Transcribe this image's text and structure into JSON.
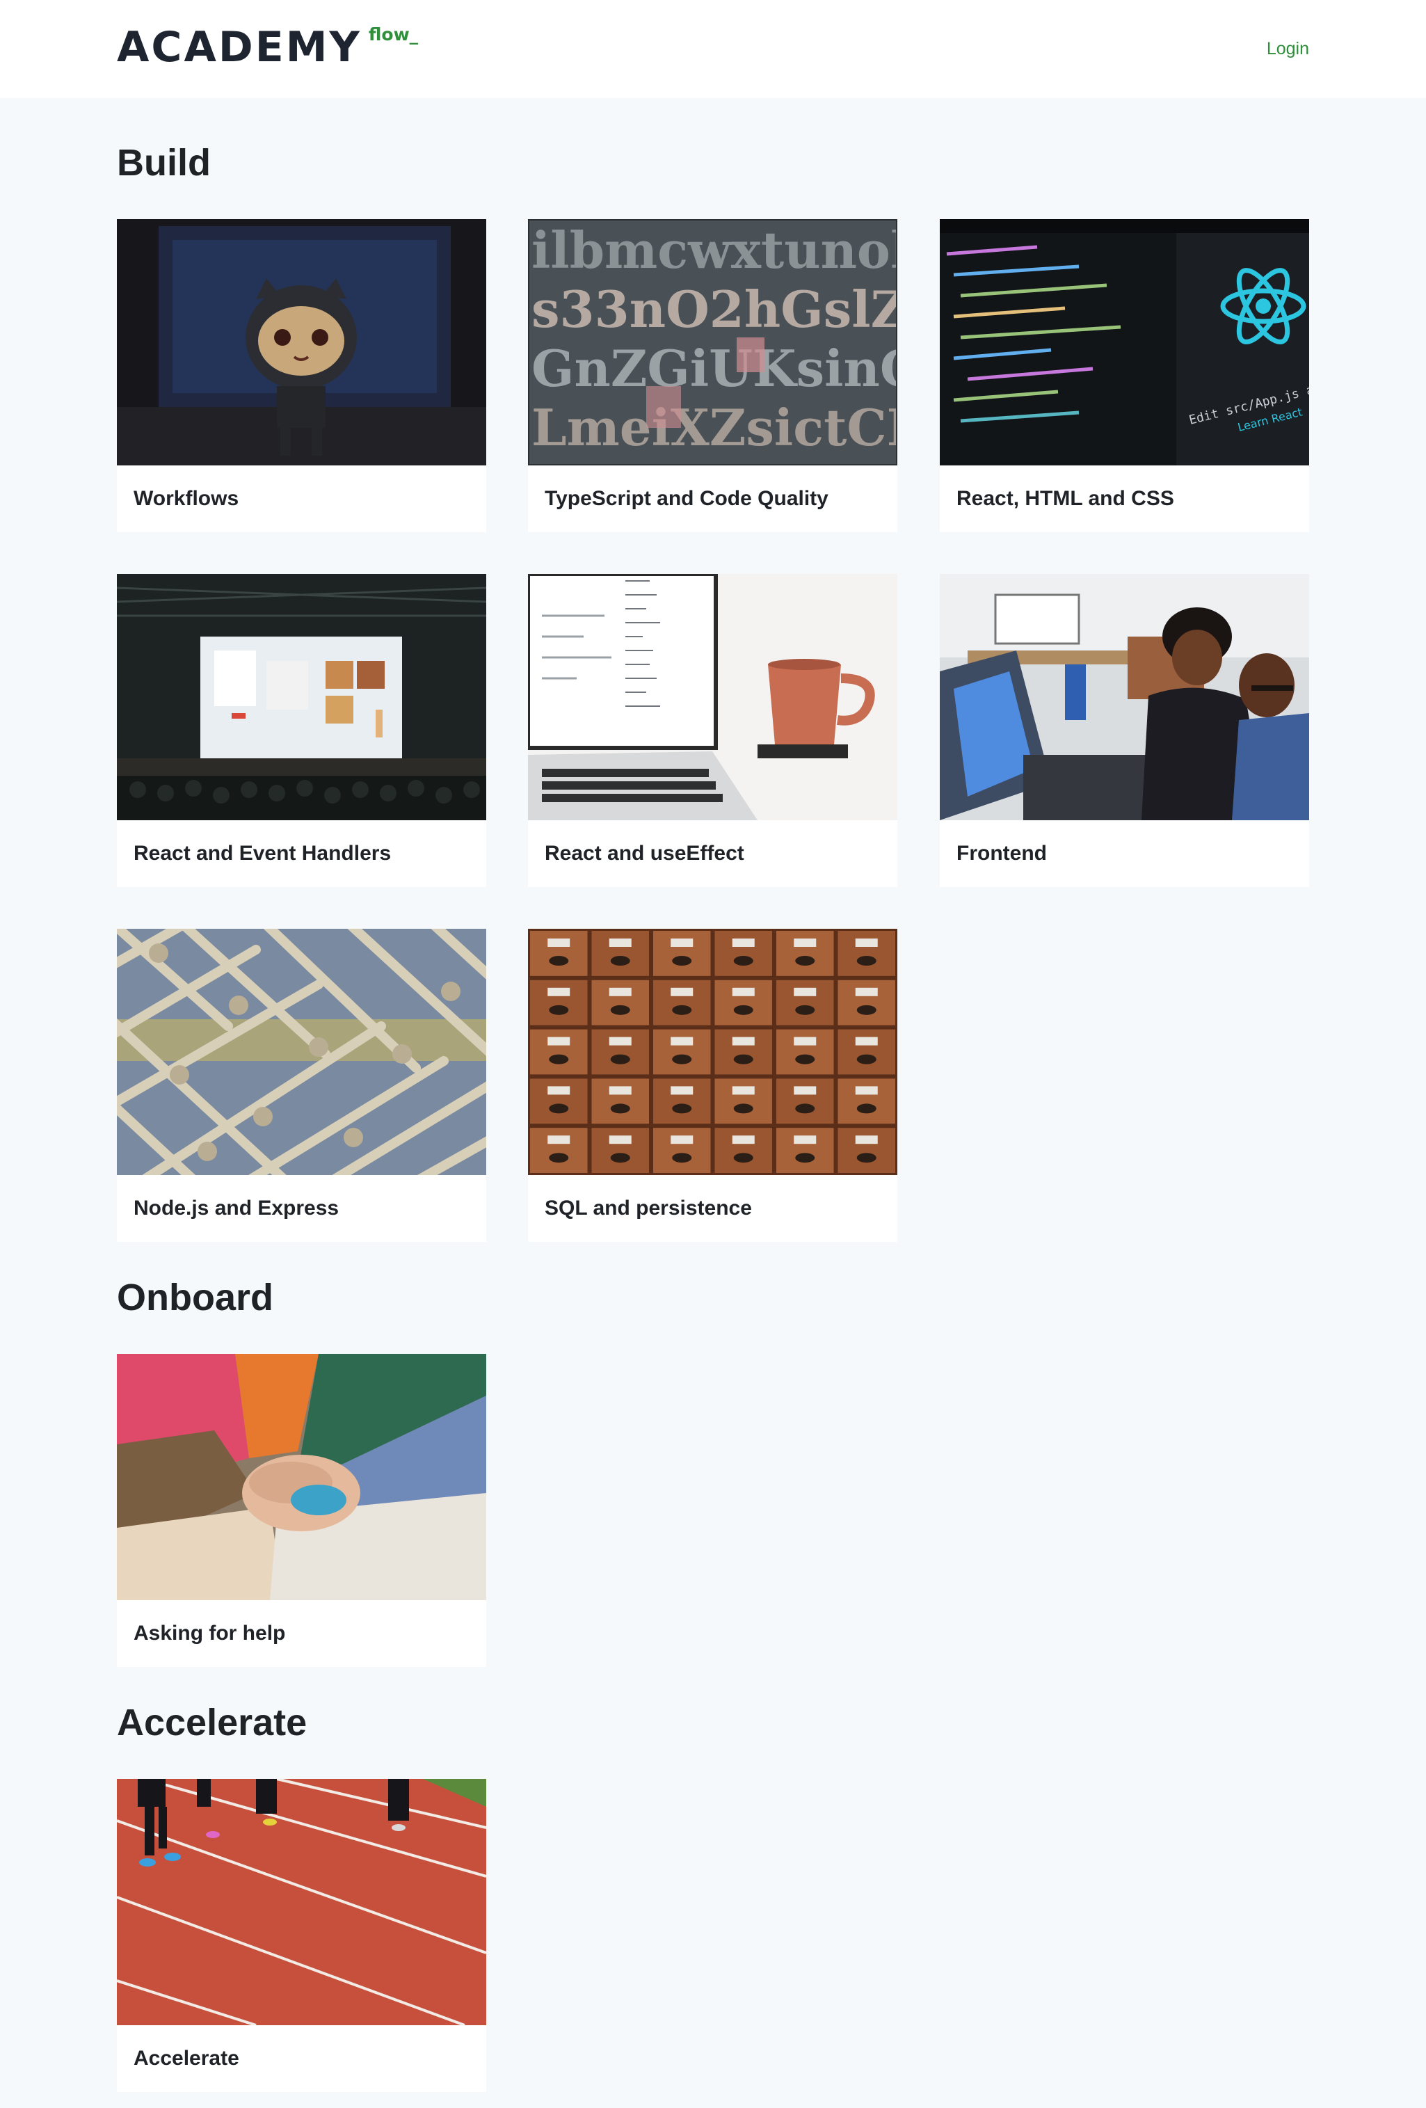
{
  "header": {
    "logo_main": "ACADEMY",
    "logo_sub": "flow_",
    "login_label": "Login"
  },
  "sections": [
    {
      "title": "Build",
      "cards": [
        {
          "label": "Workflows",
          "image": "octocat-figurine-photo"
        },
        {
          "label": "TypeScript and Code Quality",
          "image": "letterpress-type-photo"
        },
        {
          "label": "React, HTML and CSS",
          "image": "react-code-editor-photo"
        },
        {
          "label": "React and Event Handlers",
          "image": "conference-stage-photo"
        },
        {
          "label": "React and useEffect",
          "image": "laptop-coffee-mug-photo"
        },
        {
          "label": "Frontend",
          "image": "coworkers-at-laptop-photo"
        },
        {
          "label": "Node.js and Express",
          "image": "rope-net-photo"
        },
        {
          "label": "SQL and persistence",
          "image": "card-catalog-drawers-photo"
        }
      ]
    },
    {
      "title": "Onboard",
      "cards": [
        {
          "label": "Asking for help",
          "image": "team-hands-stack-photo"
        }
      ]
    },
    {
      "title": "Accelerate",
      "cards": [
        {
          "label": "Accelerate",
          "image": "running-track-photo"
        }
      ]
    }
  ],
  "colors": {
    "accent": "#2f8f3a",
    "page_bg": "#f6f9fc",
    "card_bg": "#ffffff",
    "text": "#1f2328"
  }
}
